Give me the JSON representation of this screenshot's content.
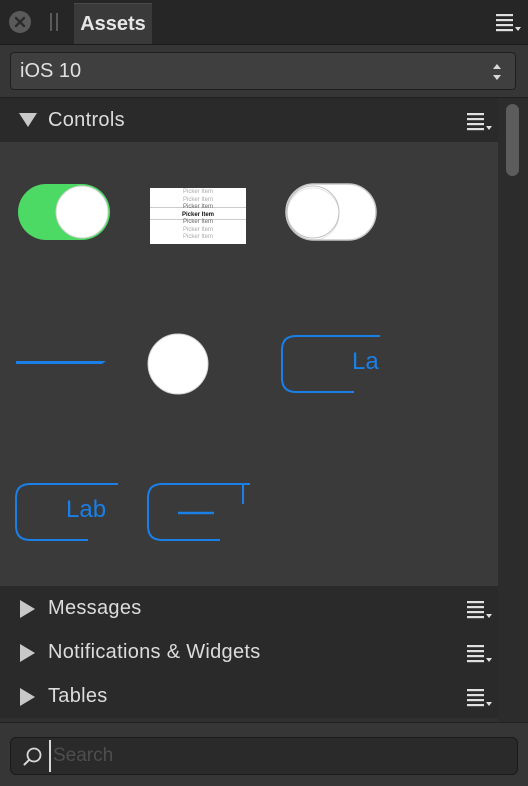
{
  "tabbar": {
    "active_tab": "Assets",
    "close_icon": "close-circle-icon",
    "menu_icon": "hamburger-menu-icon"
  },
  "category": {
    "selected": "iOS 10"
  },
  "sections": [
    {
      "label": "Controls",
      "expanded": true
    },
    {
      "label": "Messages",
      "expanded": false
    },
    {
      "label": "Notifications & Widgets",
      "expanded": false
    },
    {
      "label": "Tables",
      "expanded": false
    }
  ],
  "controls": {
    "picker_items": [
      "Picker Item",
      "Picker Item",
      "Picker Item",
      "Picker Item",
      "Picker Item",
      "Picker Item",
      "Picker Item"
    ],
    "button_label_1": "La",
    "button_label_2": "Lab"
  },
  "search": {
    "placeholder": "Search",
    "value": ""
  },
  "colors": {
    "accent_blue": "#1a7fe6",
    "switch_green": "#4cd964"
  }
}
